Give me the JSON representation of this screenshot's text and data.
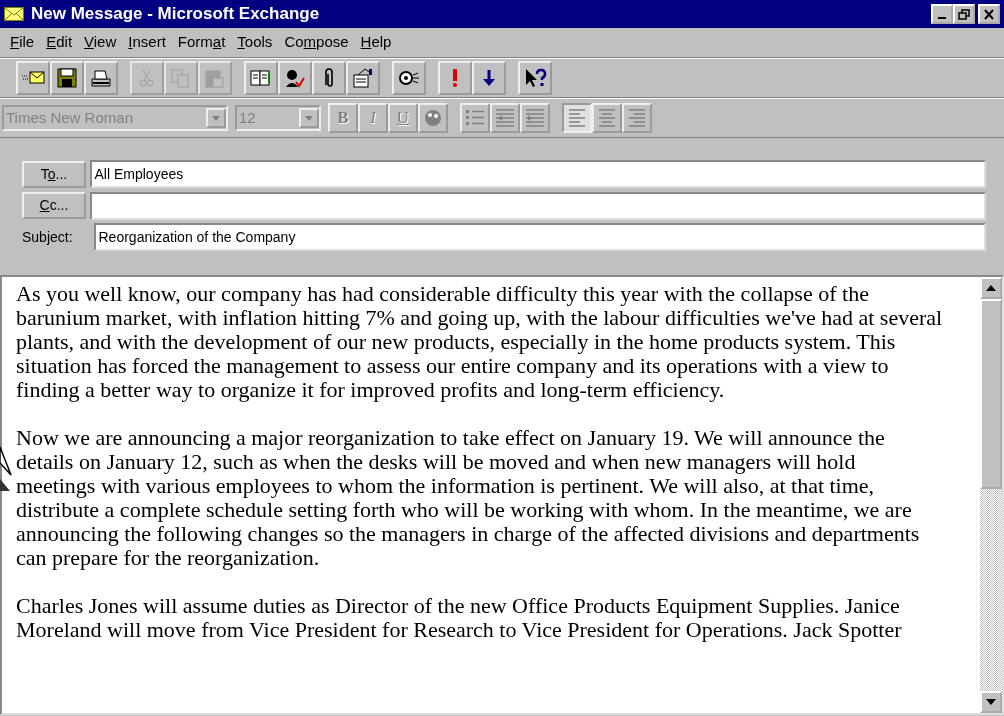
{
  "window": {
    "title": "New Message - Microsoft Exchange"
  },
  "menu": [
    {
      "key": "F",
      "post": "ile"
    },
    {
      "key": "E",
      "post": "dit"
    },
    {
      "key": "V",
      "post": "iew"
    },
    {
      "key": "I",
      "post": "nsert"
    },
    {
      "pre": "Form",
      "key": "a",
      "post": "t"
    },
    {
      "key": "T",
      "post": "ools"
    },
    {
      "pre": "Co",
      "key": "m",
      "post": "pose"
    },
    {
      "key": "H",
      "post": "elp"
    }
  ],
  "toolbar": [
    [
      {
        "kind": "send",
        "disabled": false
      },
      {
        "kind": "save",
        "disabled": false
      },
      {
        "kind": "print",
        "disabled": false
      }
    ],
    [
      {
        "kind": "cut",
        "disabled": true
      },
      {
        "kind": "copy",
        "disabled": true
      },
      {
        "kind": "paste",
        "disabled": true
      }
    ],
    [
      {
        "kind": "book",
        "disabled": false
      },
      {
        "kind": "names",
        "disabled": false
      },
      {
        "kind": "clip",
        "disabled": false
      },
      {
        "kind": "props",
        "disabled": false
      }
    ],
    [
      {
        "kind": "receipt",
        "disabled": false
      }
    ],
    [
      {
        "kind": "high",
        "disabled": false
      },
      {
        "kind": "low",
        "disabled": false
      }
    ],
    [
      {
        "kind": "help",
        "disabled": false
      }
    ]
  ],
  "format_bar": {
    "font": {
      "value": "Times New Roman",
      "disabled": true
    },
    "size": {
      "value": "12",
      "disabled": true
    },
    "buttons": [
      [
        {
          "kind": "bold",
          "label": "B",
          "disabled": true,
          "selected": false
        },
        {
          "kind": "italic",
          "label": "I",
          "disabled": true,
          "selected": false
        },
        {
          "kind": "underline",
          "label": "U",
          "disabled": true,
          "selected": false
        },
        {
          "kind": "color",
          "disabled": true,
          "selected": false
        }
      ],
      [
        {
          "kind": "bullets",
          "disabled": true,
          "selected": false
        },
        {
          "kind": "outdent",
          "disabled": true,
          "selected": false
        },
        {
          "kind": "indent",
          "disabled": true,
          "selected": false
        }
      ],
      [
        {
          "kind": "left",
          "disabled": true,
          "selected": true
        },
        {
          "kind": "center",
          "disabled": true,
          "selected": false
        },
        {
          "kind": "right",
          "disabled": true,
          "selected": false
        }
      ]
    ]
  },
  "header": {
    "to": {
      "pre": "T",
      "key": "o",
      "post": "...",
      "value": "All Employees"
    },
    "cc": {
      "key": "C",
      "post": "c..."
    },
    "subject": {
      "label": "Subject:",
      "value": "Reorganization of the Company"
    }
  },
  "body": [
    [
      "As you well know, our company has had considerable difficulty this year with the collapse of the",
      "barunium market, with inflation hitting 7% and going up, with the labour difficulties we've had at several",
      "plants, and with the development of our new products, especially in the home products system.  This",
      "situation has forced the management to assess our entire company and its operations with a view to",
      "finding a better way to organize it for improved profits and long-term efficiency."
    ],
    [
      "Now we are announcing a major reorganization to take effect on January 19.  We will announce  the",
      "details on January 12, such as when the desks will be moved and when new managers will hold",
      "meetings with various employees to whom the information is pertinent.  We will also, at that time,",
      "distribute a complete schedule setting forth who will be working with whom.  In the meantime, we are",
      "announcing the following changes so the managers in charge of the affected divisions and departments",
      "can prepare for the reorganization."
    ],
    [
      "Charles Jones will assume duties as Director of the new Office Products Equipment Supplies.  Janice",
      "Moreland will move from Vice President for Research to Vice President for Operations.  Jack Spotter"
    ]
  ]
}
